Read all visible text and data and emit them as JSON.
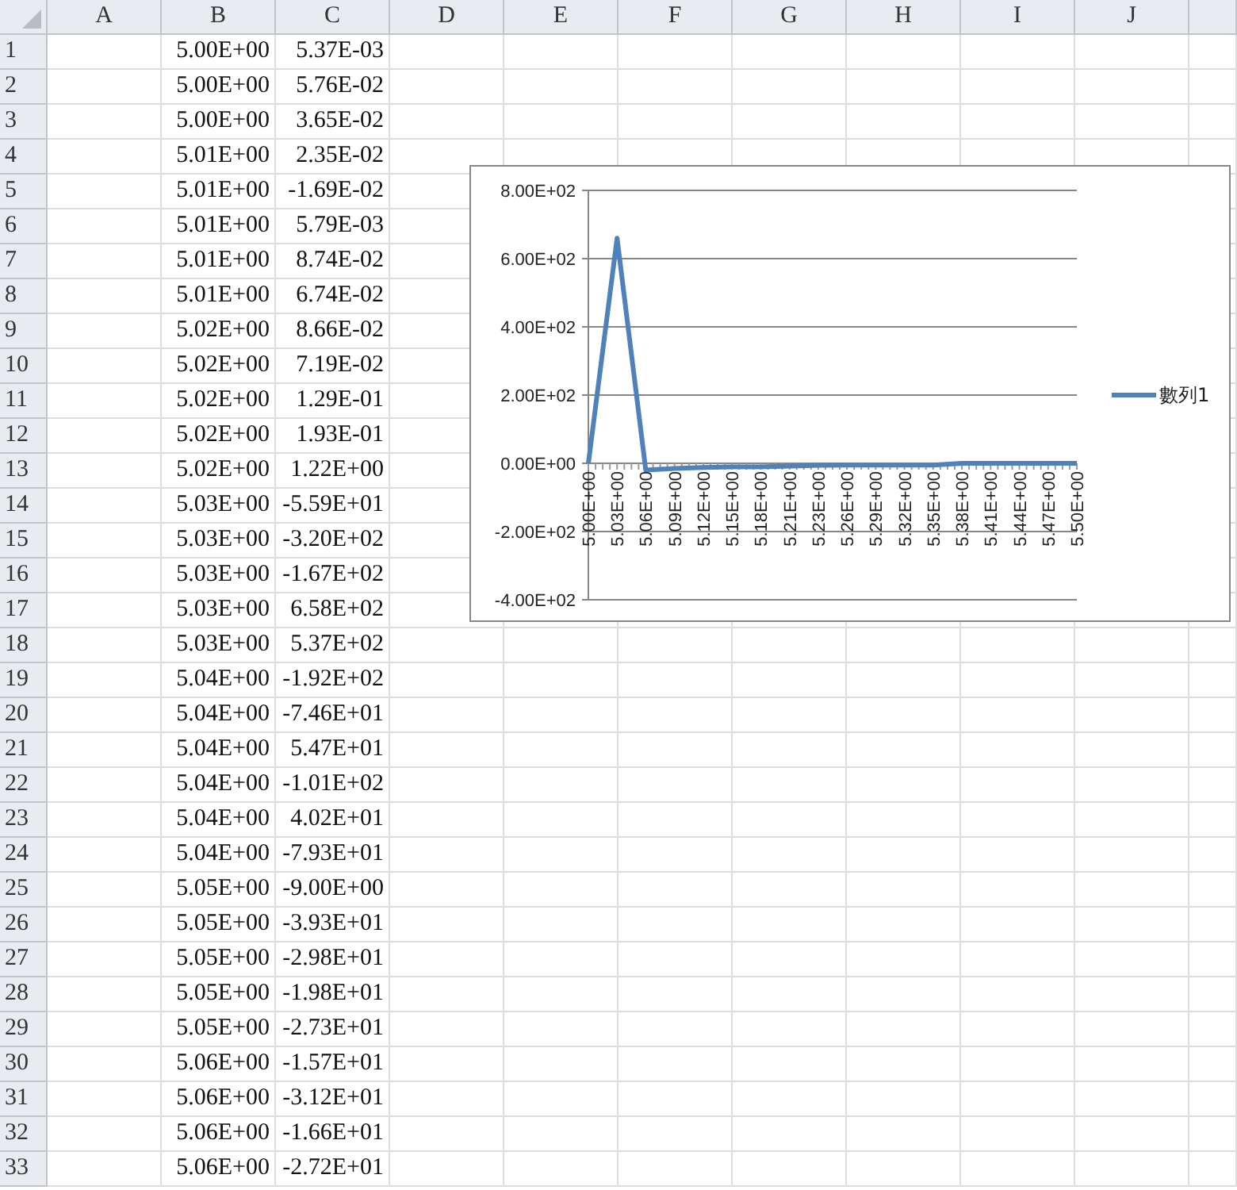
{
  "sheet": {
    "columns": [
      "A",
      "B",
      "C",
      "D",
      "E",
      "F",
      "G",
      "H",
      "I",
      "J"
    ],
    "rows": [
      {
        "label": "1",
        "values": [
          "5.00E+00",
          "5.37E-03"
        ]
      },
      {
        "label": "2",
        "values": [
          "5.00E+00",
          "5.76E-02"
        ]
      },
      {
        "label": "3",
        "values": [
          "5.00E+00",
          "3.65E-02"
        ]
      },
      {
        "label": "4",
        "values": [
          "5.01E+00",
          "2.35E-02"
        ]
      },
      {
        "label": "5",
        "values": [
          "5.01E+00",
          "-1.69E-02"
        ]
      },
      {
        "label": "6",
        "values": [
          "5.01E+00",
          "5.79E-03"
        ]
      },
      {
        "label": "7",
        "values": [
          "5.01E+00",
          "8.74E-02"
        ]
      },
      {
        "label": "8",
        "values": [
          "5.01E+00",
          "6.74E-02"
        ]
      },
      {
        "label": "9",
        "values": [
          "5.02E+00",
          "8.66E-02"
        ]
      },
      {
        "label": "10",
        "values": [
          "5.02E+00",
          "7.19E-02"
        ]
      },
      {
        "label": "11",
        "values": [
          "5.02E+00",
          "1.29E-01"
        ]
      },
      {
        "label": "12",
        "values": [
          "5.02E+00",
          "1.93E-01"
        ]
      },
      {
        "label": "13",
        "values": [
          "5.02E+00",
          "1.22E+00"
        ]
      },
      {
        "label": "14",
        "values": [
          "5.03E+00",
          "-5.59E+01"
        ]
      },
      {
        "label": "15",
        "values": [
          "5.03E+00",
          "-3.20E+02"
        ]
      },
      {
        "label": "16",
        "values": [
          "5.03E+00",
          "-1.67E+02"
        ]
      },
      {
        "label": "17",
        "values": [
          "5.03E+00",
          "6.58E+02"
        ]
      },
      {
        "label": "18",
        "values": [
          "5.03E+00",
          "5.37E+02"
        ]
      },
      {
        "label": "19",
        "values": [
          "5.04E+00",
          "-1.92E+02"
        ]
      },
      {
        "label": "20",
        "values": [
          "5.04E+00",
          "-7.46E+01"
        ]
      },
      {
        "label": "21",
        "values": [
          "5.04E+00",
          "5.47E+01"
        ]
      },
      {
        "label": "22",
        "values": [
          "5.04E+00",
          "-1.01E+02"
        ]
      },
      {
        "label": "23",
        "values": [
          "5.04E+00",
          "4.02E+01"
        ]
      },
      {
        "label": "24",
        "values": [
          "5.04E+00",
          "-7.93E+01"
        ]
      },
      {
        "label": "25",
        "values": [
          "5.05E+00",
          "-9.00E+00"
        ]
      },
      {
        "label": "26",
        "values": [
          "5.05E+00",
          "-3.93E+01"
        ]
      },
      {
        "label": "27",
        "values": [
          "5.05E+00",
          "-2.98E+01"
        ]
      },
      {
        "label": "28",
        "values": [
          "5.05E+00",
          "-1.98E+01"
        ]
      },
      {
        "label": "29",
        "values": [
          "5.05E+00",
          "-2.73E+01"
        ]
      },
      {
        "label": "30",
        "values": [
          "5.06E+00",
          "-1.57E+01"
        ]
      },
      {
        "label": "31",
        "values": [
          "5.06E+00",
          "-3.12E+01"
        ]
      },
      {
        "label": "32",
        "values": [
          "5.06E+00",
          "-1.66E+01"
        ]
      },
      {
        "label": "33",
        "values": [
          "5.06E+00",
          "-2.72E+01"
        ]
      }
    ]
  },
  "chart": {
    "chart_data": {
      "type": "line",
      "ylim": [
        -400,
        800
      ],
      "yticks": [
        {
          "value": 800,
          "label": "8.00E+02"
        },
        {
          "value": 600,
          "label": "6.00E+02"
        },
        {
          "value": 400,
          "label": "4.00E+02"
        },
        {
          "value": 200,
          "label": "2.00E+02"
        },
        {
          "value": 0,
          "label": "0.00E+00"
        },
        {
          "value": -200,
          "label": "-2.00E+02"
        },
        {
          "value": -400,
          "label": "-4.00E+02"
        }
      ],
      "grid": true,
      "categories": [
        "5.00E+00",
        "5.03E+00",
        "5.06E+00",
        "5.09E+00",
        "5.12E+00",
        "5.15E+00",
        "5.18E+00",
        "5.21E+00",
        "5.23E+00",
        "5.26E+00",
        "5.29E+00",
        "5.32E+00",
        "5.35E+00",
        "5.38E+00",
        "5.41E+00",
        "5.44E+00",
        "5.47E+00",
        "5.50E+00"
      ],
      "series": [
        {
          "name": "數列1",
          "color": "#4f81bd",
          "values": [
            0,
            660,
            -20,
            -15,
            -12,
            -10,
            -10,
            -8,
            -6,
            -5,
            -5,
            -5,
            -5,
            0,
            0,
            0,
            0,
            0
          ]
        }
      ]
    }
  }
}
